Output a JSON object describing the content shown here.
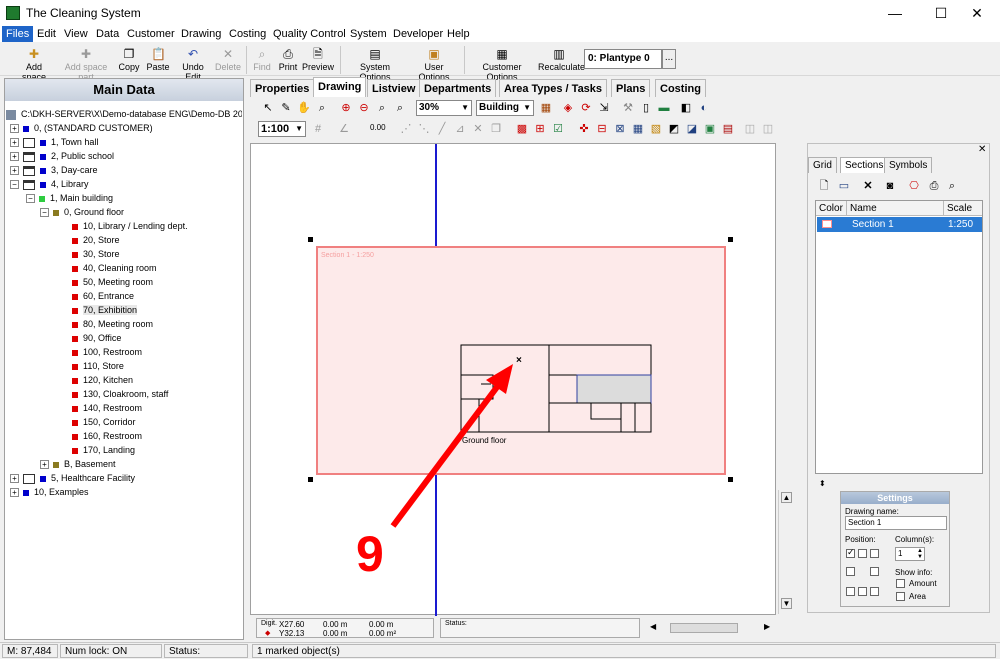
{
  "window": {
    "title": "The Cleaning System",
    "minimize": "—",
    "maximize": "☐",
    "close": "✕"
  },
  "menu": [
    "Files",
    "Edit",
    "View",
    "Data",
    "Customer",
    "Drawing",
    "Costing",
    "Quality Control",
    "System",
    "Developer",
    "Help"
  ],
  "toolbar": {
    "add_space": "Add space",
    "add_space_part": "Add space part",
    "copy": "Copy",
    "paste": "Paste",
    "undo_edit": "Undo Edit",
    "delete": "Delete",
    "find": "Find",
    "print": "Print",
    "preview": "Preview",
    "system_options": "System Options",
    "user_options": "User Options",
    "customer_options": "Customer Options",
    "recalculate": "Recalculate",
    "plantype": "0: Plantype 0",
    "plantype_more": "..."
  },
  "left": {
    "header": "Main Data",
    "items": [
      "C:\\DKH-SERVER\\X\\Demo-database ENG\\Demo-DB 2006 Engl",
      "0, (STANDARD CUSTOMER)",
      "1, Town hall",
      "2, Public school",
      "3, Day-care",
      "4, Library",
      "1, Main building",
      "0, Ground floor",
      "10, Library / Lending dept.",
      "20, Store",
      "30, Store",
      "40, Cleaning room",
      "50, Meeting room",
      "60, Entrance",
      "70, Exhibition",
      "80, Meeting room",
      "90, Office",
      "100, Restroom",
      "110, Store",
      "120, Kitchen",
      "130, Cloakroom, staff",
      "140, Restroom",
      "150, Corridor",
      "160, Restroom",
      "170, Landing",
      "B, Basement",
      "5, Healthcare Facility",
      "10, Examples"
    ]
  },
  "tabs": [
    "Properties",
    "Drawing",
    "Listview",
    "Departments",
    "Area Types / Tasks",
    "Plans",
    "Costing"
  ],
  "drawing_toolbar": {
    "zoom": "30%",
    "building": "Building",
    "scale": "1:100",
    "value": "0.00"
  },
  "canvas": {
    "section_label": "Section 1 - 1:250",
    "floor_label": "Ground floor",
    "annotation_number": "9",
    "marker": "×"
  },
  "right": {
    "tabs": [
      "Grid",
      "Sections",
      "Symbols"
    ],
    "columns": [
      "Color",
      "Name",
      "Scale"
    ],
    "rows": [
      {
        "name": "Section 1",
        "scale": "1:250"
      }
    ],
    "settings": {
      "title": "Settings",
      "drawing_name_label": "Drawing name:",
      "drawing_name": "Section 1",
      "position_label": "Position:",
      "columns_label": "Column(s):",
      "columns_value": "1",
      "show_info_label": "Show info:",
      "amount": "Amount",
      "area": "Area"
    }
  },
  "info": {
    "digit_label": "Digit.",
    "x": "X27.60",
    "y": "Y32.13",
    "dx": "0.00 m",
    "dy": "0.00 m",
    "ab": "0.00 m",
    "area": "0.00 m²",
    "status_label": "Status:"
  },
  "statusbar": {
    "memory": "M: 87,484 K",
    "numlock": "Num lock: ON",
    "status": "Status:",
    "message": "1 marked object(s)"
  }
}
